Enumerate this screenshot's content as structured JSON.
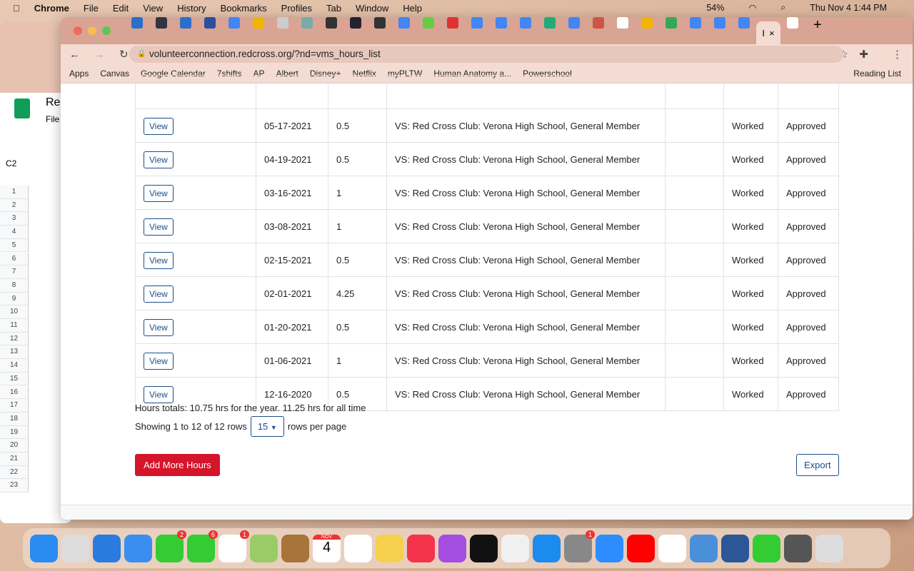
{
  "menubar": {
    "app": "Chrome",
    "items": [
      "File",
      "Edit",
      "View",
      "History",
      "Bookmarks",
      "Profiles",
      "Tab",
      "Window",
      "Help"
    ],
    "battery": "54%",
    "datetime": "Thu Nov 4  1:44 PM"
  },
  "browser": {
    "url": "volunteerconnection.redcross.org/?nd=vms_hours_list",
    "active_tab": "I",
    "tab_colors": [
      "#2a6fc9",
      "#334",
      "#2a6fc9",
      "#2a4f9c",
      "#4285f4",
      "#f4b400",
      "#ccc",
      "#7aa",
      "#333",
      "#223",
      "#333",
      "#4285f4",
      "#6c4",
      "#d33",
      "#4285f4",
      "#4285f4",
      "#4285f4",
      "#2a7",
      "#4285f4",
      "#c54",
      "#fff",
      "#f4b400",
      "#34a853",
      "#4285f4",
      "#4285f4",
      "#4285f4",
      "#fff"
    ],
    "bookmarks": [
      "Apps",
      "Canvas",
      "Google Calendar",
      "7shifts",
      "AP",
      "Albert",
      "Disney+",
      "Netflix",
      "myPLTW",
      "Human Anatomy a...",
      "Powerschool"
    ],
    "reading_list": "Reading List"
  },
  "sheet": {
    "app": "Rec",
    "menu": "File",
    "cell": "C2",
    "rows": [
      "1",
      "2",
      "3",
      "4",
      "5",
      "6",
      "7",
      "8",
      "9",
      "10",
      "11",
      "12",
      "13",
      "14",
      "15",
      "16",
      "17",
      "18",
      "19",
      "20",
      "21",
      "22",
      "23"
    ]
  },
  "hours": {
    "view_label": "View",
    "rows": [
      {
        "date": "05-17-2021",
        "hours": "0.5",
        "desc": "VS: Red Cross Club: Verona High School, General Member",
        "type": "Worked",
        "status": "Approved"
      },
      {
        "date": "04-19-2021",
        "hours": "0.5",
        "desc": "VS: Red Cross Club: Verona High School, General Member",
        "type": "Worked",
        "status": "Approved"
      },
      {
        "date": "03-16-2021",
        "hours": "1",
        "desc": "VS: Red Cross Club: Verona High School, General Member",
        "type": "Worked",
        "status": "Approved"
      },
      {
        "date": "03-08-2021",
        "hours": "1",
        "desc": "VS: Red Cross Club: Verona High School, General Member",
        "type": "Worked",
        "status": "Approved"
      },
      {
        "date": "02-15-2021",
        "hours": "0.5",
        "desc": "VS: Red Cross Club: Verona High School, General Member",
        "type": "Worked",
        "status": "Approved"
      },
      {
        "date": "02-01-2021",
        "hours": "4.25",
        "desc": "VS: Red Cross Club: Verona High School, General Member",
        "type": "Worked",
        "status": "Approved"
      },
      {
        "date": "01-20-2021",
        "hours": "0.5",
        "desc": "VS: Red Cross Club: Verona High School, General Member",
        "type": "Worked",
        "status": "Approved"
      },
      {
        "date": "01-06-2021",
        "hours": "1",
        "desc": "VS: Red Cross Club: Verona High School, General Member",
        "type": "Worked",
        "status": "Approved"
      },
      {
        "date": "12-16-2020",
        "hours": "0.5",
        "desc": "VS: Red Cross Club: Verona High School, General Member",
        "type": "Worked",
        "status": "Approved"
      }
    ],
    "totals": "Hours totals: 10.75 hrs for the year. 11.25 hrs for all time",
    "showing": "Showing 1 to 12 of 12 rows",
    "page_size": "15",
    "per_page": "rows per page",
    "add_label": "Add More Hours",
    "export_label": "Export"
  },
  "dock": {
    "colors": [
      "#2a8cf0",
      "#ddd",
      "#2a7be0",
      "#3a8ef0",
      "#3c3",
      "#3c3",
      "#fff",
      "#9c6",
      "#a8743a",
      "#fff",
      "#fff",
      "#f6d04d",
      "#f2334a",
      "#a34ee0",
      "#111",
      "#f0f0f0",
      "#1a8cf0",
      "#888",
      "#2d8cff",
      "#f00",
      "#fff",
      "#4a90d9",
      "#2b5797",
      "#3c3",
      "#555",
      "#ddd"
    ],
    "badges": {
      "4": "2",
      "5": "6",
      "6": "1",
      "17": "1"
    },
    "calendar_month": "NOV",
    "calendar_day": "4"
  }
}
